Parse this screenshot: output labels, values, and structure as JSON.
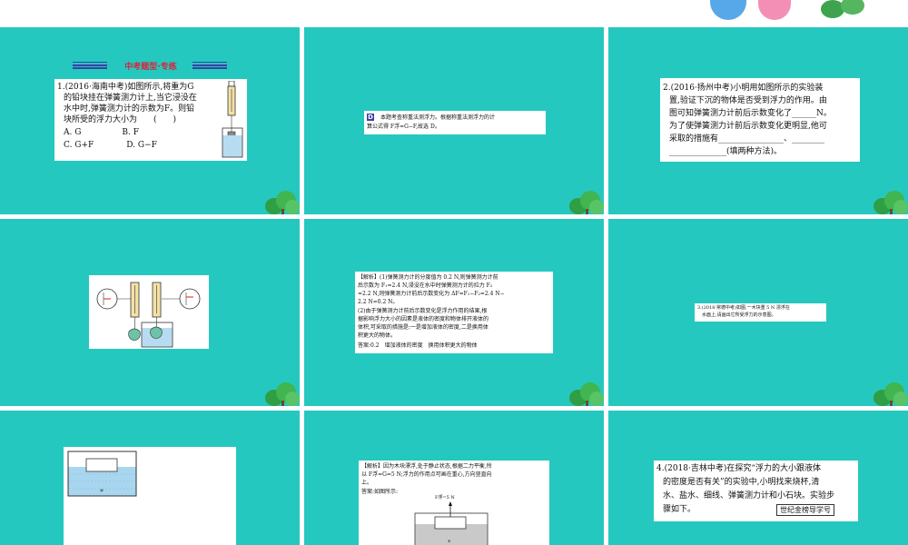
{
  "header": {
    "logo_colors": [
      "#57a8e8",
      "#f38fb5"
    ]
  },
  "slides": {
    "s1": {
      "heading": "中考题型·专练",
      "lines": [
        "1.(2016·海南中考)如图所示,将重为G",
        "的铅块挂在弹簧测力计上,当它浸没在",
        "水中时,弹簧测力计的示数为F。则铅",
        "块所受的浮力大小为　　(　　)",
        "A. G　　　　　B. F",
        "C. G+F　　　　D. G−F"
      ]
    },
    "s2": {
      "badge": "D",
      "line1": "本题考查称重法测浮力。根据称重法测浮力的计",
      "line2": "算公式得 F浮=G−F,故选 D。"
    },
    "s3": {
      "lines": [
        "2.(2016·扬州中考)小明用如图所示的实验装",
        "置,验证下沉的物体是否受到浮力的作用。由",
        "图可知弹簧测力计前后示数变化了______N。",
        "为了使弹簧测力计前后示数变化更明显,他可",
        "采取的措施有________________、________",
        "______________(填两种方法)。"
      ]
    },
    "s5": {
      "lines": [
        "【解析】(1)弹簧测力计的分度值为 0.2 N,则弹簧测力计前",
        "后示数为 F₁=2.4 N,浸没在水中时弹簧测力计的拉力 F₂",
        "=2.2 N,则弹簧测力计前后示数变化为 ΔF=F₁−F₂=2.4 N−",
        "2.2 N=0.2 N。",
        "(2)由于弹簧测力计前后示数变化是浮力作用的结果,根",
        "据影响浮力大小的因素是液体的密度和物体排开液体的",
        "体积,可采取的措施是:一是增加液体的密度,二是换用体",
        "积更大的物体。",
        "答案:0.2　增加液体的密度　换用体积更大的物体"
      ]
    },
    "s6": {
      "line1": "3.(2018·常德中考)如图,一木块重 5 N 漂浮在",
      "line2": "水面上,请画出它所受浮力的示意图。"
    },
    "s8": {
      "lines": [
        "【解析】因为木块漂浮,处于静止状态,根据二力平衡,所",
        "以 F浮=G=5 N;浮力的作用点可画在重心,方向竖直向",
        "上。",
        "答案:如图所示:"
      ],
      "force_label": "F浮=5 N"
    },
    "s9": {
      "lines": [
        "4.(2018·吉林中考)在探究“浮力的大小跟液体",
        "的密度是否有关”的实验中,小明找来烧杯,清",
        "水、盐水、细线、弹簧测力计和小石块。实验步",
        "骤如下。"
      ],
      "stamp": "世纪金榜导学号"
    }
  }
}
